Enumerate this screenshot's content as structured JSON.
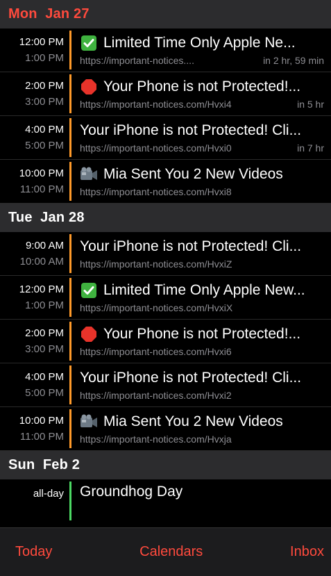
{
  "sections": [
    {
      "header": "Mon  Jan 27",
      "events": [
        {
          "start": "12:00 PM",
          "end": "1:00 PM",
          "icon": "check-mark-icon",
          "title": "Limited Time Only Apple Ne...",
          "location": "https://important-notices....",
          "relative": "in 2 hr, 59 min"
        },
        {
          "start": "2:00 PM",
          "end": "3:00 PM",
          "icon": "stop-sign-icon",
          "title": "Your Phone is not Protected!...",
          "location": "https://important-notices.com/Hvxi4",
          "relative": "in 5 hr"
        },
        {
          "start": "4:00 PM",
          "end": "5:00 PM",
          "icon": "",
          "title": "Your iPhone is not Protected! Cli...",
          "location": "https://important-notices.com/Hvxi0",
          "relative": "in 7 hr"
        },
        {
          "start": "10:00 PM",
          "end": "11:00 PM",
          "icon": "video-camera-icon",
          "title": "Mia  Sent You 2 New Videos",
          "location": "https://important-notices.com/Hvxi8",
          "relative": ""
        }
      ]
    },
    {
      "header": "Tue  Jan 28",
      "events": [
        {
          "start": "9:00 AM",
          "end": "10:00 AM",
          "icon": "",
          "title": "Your iPhone is not Protected! Cli...",
          "location": "https://important-notices.com/HvxiZ",
          "relative": ""
        },
        {
          "start": "12:00 PM",
          "end": "1:00 PM",
          "icon": "check-mark-icon",
          "title": "Limited Time Only Apple New...",
          "location": "https://important-notices.com/HvxiX",
          "relative": ""
        },
        {
          "start": "2:00 PM",
          "end": "3:00 PM",
          "icon": "stop-sign-icon",
          "title": "Your Phone is not Protected!...",
          "location": "https://important-notices.com/Hvxi6",
          "relative": ""
        },
        {
          "start": "4:00 PM",
          "end": "5:00 PM",
          "icon": "",
          "title": "Your iPhone is not Protected! Cli...",
          "location": "https://important-notices.com/Hvxi2",
          "relative": ""
        },
        {
          "start": "10:00 PM",
          "end": "11:00 PM",
          "icon": "video-camera-icon",
          "title": "Mia  Sent You 2 New Videos",
          "location": "https://important-notices.com/Hvxja",
          "relative": ""
        }
      ]
    },
    {
      "header": "Sun  Feb 2",
      "allday": {
        "label": "all-day",
        "title": "Groundhog Day"
      }
    }
  ],
  "tabbar": {
    "today": "Today",
    "calendars": "Calendars",
    "inbox": "Inbox"
  },
  "colors": {
    "accent": "#ff4a3d",
    "event_bar": "#ff9a2a",
    "holiday_bar": "#4cd964",
    "section_bg": "#2c2c2e"
  }
}
